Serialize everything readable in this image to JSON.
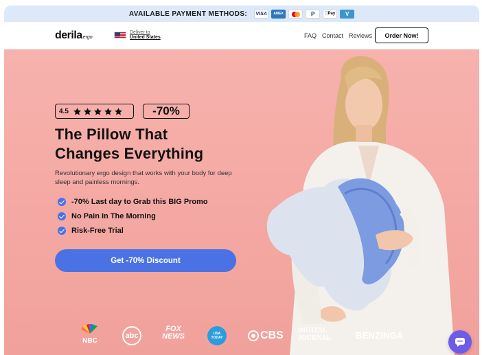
{
  "payment_bar": {
    "label": "AVAILABLE PAYMENT METHODS:",
    "methods": [
      "VISA",
      "AMEX",
      "Mastercard",
      "PayPal",
      "Apple Pay",
      "V"
    ]
  },
  "nav": {
    "logo": "derila",
    "logo_sub": "ergo",
    "deliver_to": "Deliver to",
    "country": "United States",
    "links": [
      "FAQ",
      "Contact",
      "Reviews"
    ],
    "order_button": "Order Now!"
  },
  "hero": {
    "rating": "4.5",
    "stars": 5,
    "discount": "-70%",
    "headline_line1": "The Pillow That",
    "headline_line2": "Changes Everything",
    "subtext": "Revolutionary ergo design that works with your body for deep sleep and painless mornings.",
    "bullets": [
      "-70% Last day to Grab this BIG Promo",
      "No Pain In The Morning",
      "Risk-Free Trial"
    ],
    "cta": "Get -70% Discount"
  },
  "press": {
    "nbc": "NBC",
    "abc": "abc",
    "fox_1": "FOX",
    "fox_2": "NEWS",
    "usa_1": "USA",
    "usa_2": "TODAY",
    "cbs": "CBS",
    "dj_1": "DIGITAL",
    "dj_2": "JOURNAL",
    "benzinga": "BENZINGA"
  },
  "colors": {
    "hero_bg": "#f5aca7",
    "accent_blue": "#4a72e4",
    "payment_bar_bg": "#dde9f8",
    "chat_purple": "#6c5ce7"
  },
  "icons": [
    "star-icon",
    "check-icon",
    "chat-icon",
    "flag-us-icon"
  ]
}
